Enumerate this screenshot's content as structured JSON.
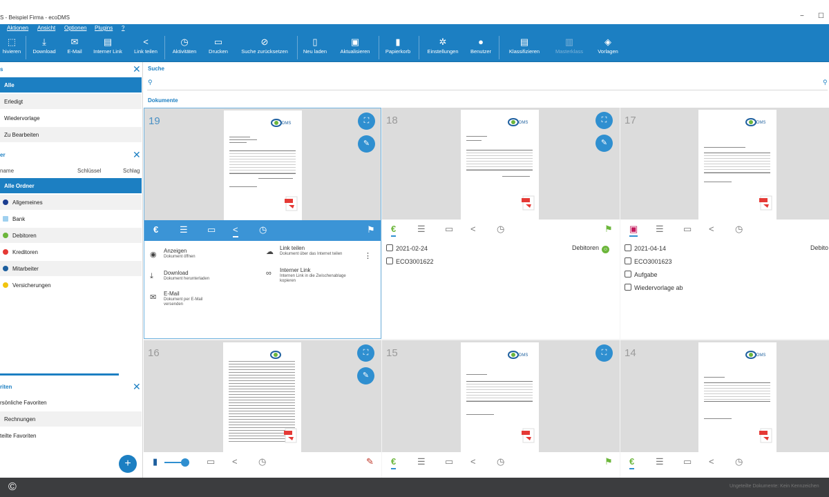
{
  "window": {
    "title": "S - Beispiel Firma - ecoDMS",
    "minimize": "−",
    "maximize": "☐"
  },
  "menu": [
    "Aktionen",
    "Ansicht",
    "Optionen",
    "Plugins",
    "?"
  ],
  "toolbar": [
    {
      "label": "hivieren",
      "icon": "archive-icon",
      "glyph": "⬚"
    },
    {
      "label": "Download",
      "icon": "download-icon",
      "glyph": "⤓"
    },
    {
      "label": "E-Mail",
      "icon": "mail-icon",
      "glyph": "✉"
    },
    {
      "label": "Interner Link",
      "icon": "internal-link-icon",
      "glyph": "▤"
    },
    {
      "label": "Link teilen",
      "icon": "share-icon",
      "glyph": "<"
    },
    {
      "label": "Aktivitäten",
      "icon": "history-icon",
      "glyph": "◷"
    },
    {
      "label": "Drucken",
      "icon": "print-icon",
      "glyph": "▭"
    },
    {
      "label": "Suche zurücksetzen",
      "icon": "reset-search-icon",
      "glyph": "⊘"
    },
    {
      "label": "Neu laden",
      "icon": "reload-icon",
      "glyph": "▯"
    },
    {
      "label": "Aktualisieren",
      "icon": "refresh-icon",
      "glyph": "▣"
    },
    {
      "label": "Papierkorb",
      "icon": "trash-icon",
      "glyph": "▮"
    },
    {
      "label": "Einstellungen",
      "icon": "gear-icon",
      "glyph": "✲"
    },
    {
      "label": "Benutzer",
      "icon": "user-icon",
      "glyph": "●"
    },
    {
      "label": "Klassifizieren",
      "icon": "classify-icon",
      "glyph": "▤"
    },
    {
      "label": "Masterklass",
      "icon": "master-class-icon",
      "glyph": "▥"
    },
    {
      "label": "Vorlagen",
      "icon": "template-icon",
      "glyph": "◈"
    }
  ],
  "left": {
    "status_header": "s",
    "status_items": [
      "Alle",
      "Erledigt",
      "Wiedervorlage",
      "Zu Bearbeiten"
    ],
    "folder_header": "er",
    "folder_columns": [
      "name",
      "Schlüssel",
      "Schlag"
    ],
    "folders": [
      {
        "label": "Alle Ordner",
        "color": ""
      },
      {
        "label": "Allgemeines",
        "color": "#1a3d8f"
      },
      {
        "label": "Bank",
        "color": "#9fd0ef"
      },
      {
        "label": "Debitoren",
        "color": "#6cb63b"
      },
      {
        "label": "Kreditoren",
        "color": "#e53935"
      },
      {
        "label": "Mitarbeiter",
        "color": "#1d5f9e"
      },
      {
        "label": "Versicherungen",
        "color": "#f1c40f"
      }
    ],
    "fav_header": "riten",
    "favorites": [
      "rsönliche Favoriten",
      "Rechnungen",
      "teilte Favoriten"
    ],
    "add_glyph": "+"
  },
  "main": {
    "search_label": "Suche",
    "search_icon": "🔍",
    "docs_label": "Dokumente",
    "cards": [
      {
        "num": "19"
      },
      {
        "num": "18",
        "date": "2021-02-24",
        "id": "ECO3001622",
        "folder": "Debitoren"
      },
      {
        "num": "17",
        "date": "2021-04-14",
        "id": "ECO3001623",
        "status": "Aufgabe",
        "extra": "Wiedervorlage ab",
        "folder": "Debito"
      },
      {
        "num": "16"
      },
      {
        "num": "15"
      },
      {
        "num": "14"
      }
    ],
    "actions": [
      {
        "title": "Anzeigen",
        "desc": "Dokument öffnen",
        "icon": "eye-icon",
        "glyph": "◉"
      },
      {
        "title": "Download",
        "desc": "Dokument herunterladen",
        "icon": "download-icon",
        "glyph": "⤓"
      },
      {
        "title": "E-Mail",
        "desc": "Dokument per E-Mail versenden",
        "icon": "mail-icon",
        "glyph": "✉"
      },
      {
        "title": "Link teilen",
        "desc": "Dokument über das Internet teilen",
        "icon": "cloud-icon",
        "glyph": "☁"
      },
      {
        "title": "Interner Link",
        "desc": "Internen Link in die Zwischenablage kopieren",
        "icon": "link-icon",
        "glyph": "∞"
      }
    ]
  },
  "status": {
    "copyright": "©",
    "right": "Ungeteilte Dokumente: Kein Kennzeichen"
  }
}
